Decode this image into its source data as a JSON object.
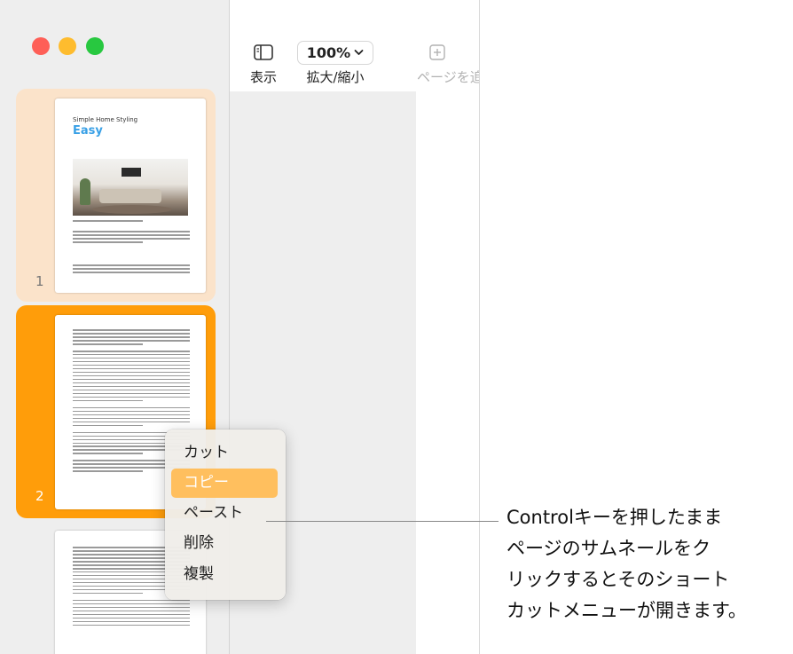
{
  "toolbar": {
    "view_label": "表示",
    "zoom_value": "100%",
    "zoom_label": "拡大/縮小",
    "add_page_label": "ページを追加"
  },
  "sidebar": {
    "pages": [
      {
        "number": "1",
        "subtitle": "Simple Home Styling",
        "title": "Easy"
      },
      {
        "number": "2"
      },
      {
        "number": ""
      }
    ]
  },
  "context_menu": {
    "items": [
      {
        "label": "カット"
      },
      {
        "label": "コピー"
      },
      {
        "label": "ペースト"
      },
      {
        "label": "削除"
      },
      {
        "label": "複製"
      }
    ],
    "active_index": 1
  },
  "callout": {
    "lines": [
      "Controlキーを押したまま",
      "ページのサムネールをク",
      "リックするとそのショート",
      "カットメニューが開きます。"
    ]
  },
  "colors": {
    "selection": "#ff9d0a",
    "selection_light": "#fbe3ca",
    "menu_highlight": "#ffbf5e",
    "title_blue": "#39a0e6"
  },
  "icons": {
    "view": "sidebar-view-icon",
    "zoom": "chevron-down-icon",
    "add_page": "plus-square-icon"
  }
}
